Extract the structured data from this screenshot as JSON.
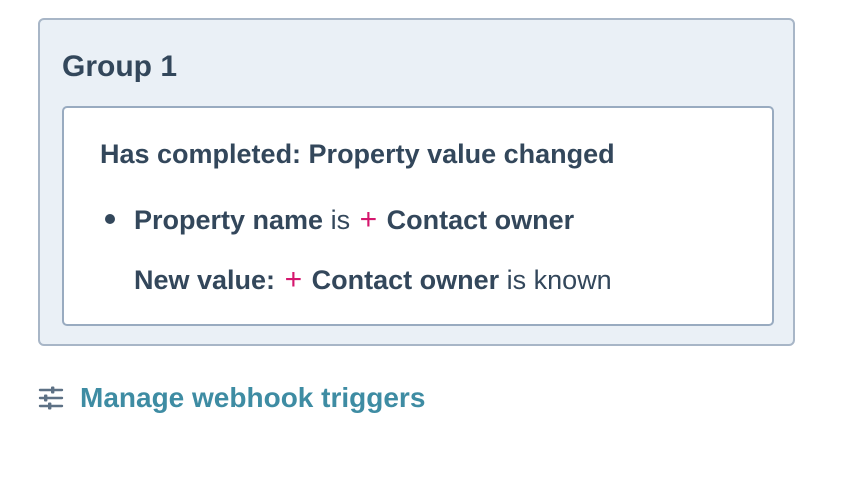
{
  "group": {
    "title": "Group 1",
    "criteria": {
      "heading": "Has completed: Property value changed",
      "line1": {
        "label": "Property name",
        "operator": "is",
        "plus": "+",
        "value": "Contact owner"
      },
      "line2": {
        "label": "New value:",
        "plus": "+",
        "value": "Contact owner",
        "suffix": "is known"
      }
    }
  },
  "manage_link": {
    "icon": "sliders-icon",
    "label": "Manage webhook triggers"
  },
  "colors": {
    "group_bg": "#eaf0f6",
    "border": "#a8b6c7",
    "text": "#33475b",
    "accent_plus": "#d5176e",
    "link": "#3e8ca3"
  }
}
